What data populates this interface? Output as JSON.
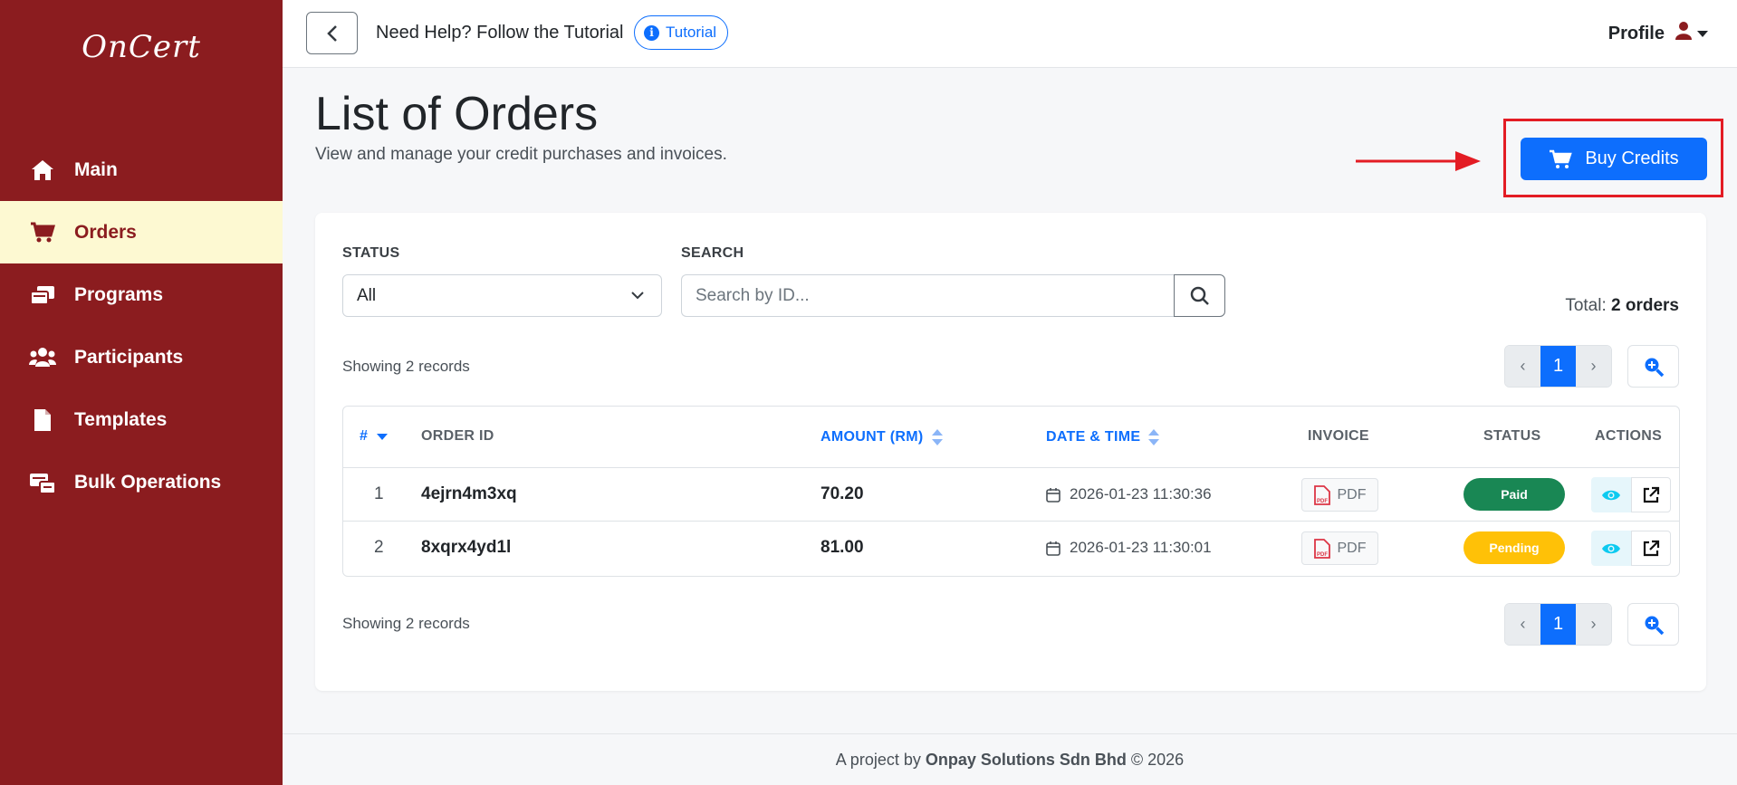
{
  "app": {
    "logo_text": "OnCert"
  },
  "sidebar": {
    "items": [
      {
        "label": "Main",
        "icon": "home-icon"
      },
      {
        "label": "Orders",
        "icon": "cart-icon",
        "active": true
      },
      {
        "label": "Programs",
        "icon": "programs-icon"
      },
      {
        "label": "Participants",
        "icon": "users-icon"
      },
      {
        "label": "Templates",
        "icon": "file-icon"
      },
      {
        "label": "Bulk Operations",
        "icon": "bulk-icon"
      }
    ]
  },
  "topbar": {
    "help_text": "Need Help? Follow the Tutorial",
    "tutorial_label": "Tutorial",
    "profile_label": "Profile"
  },
  "header": {
    "title": "List of Orders",
    "subtitle": "View and manage your credit purchases and invoices.",
    "buy_credits_label": "Buy Credits"
  },
  "filters": {
    "status_label": "STATUS",
    "status_value": "All",
    "search_label": "SEARCH",
    "search_placeholder": "Search by ID..."
  },
  "summary": {
    "total_prefix": "Total:",
    "total_value": "2 orders",
    "showing_top": "Showing 2 records",
    "showing_bottom": "Showing 2 records",
    "current_page": "1",
    "prev": "‹",
    "next": "›"
  },
  "table": {
    "headers": {
      "num": "#",
      "order_id": "ORDER ID",
      "amount": "AMOUNT (RM)",
      "datetime": "DATE & TIME",
      "invoice": "INVOICE",
      "status": "STATUS",
      "actions": "ACTIONS"
    },
    "rows": [
      {
        "num": "1",
        "order_id": "4ejrn4m3xq",
        "amount": "70.20",
        "datetime": "2026-01-23 11:30:36",
        "invoice": "PDF",
        "status": "Paid"
      },
      {
        "num": "2",
        "order_id": "8xqrx4yd1l",
        "amount": "81.00",
        "datetime": "2026-01-23 11:30:01",
        "invoice": "PDF",
        "status": "Pending"
      }
    ]
  },
  "footer": {
    "prefix": "A project by",
    "company": "Onpay Solutions Sdn Bhd",
    "suffix": "© 2026"
  },
  "colors": {
    "sidebar_bg": "#8b1c1f",
    "active_bg": "#fdf9d2",
    "primary": "#0d6efd",
    "paid": "#198754",
    "pending": "#ffc107",
    "highlight": "#e31c24"
  }
}
